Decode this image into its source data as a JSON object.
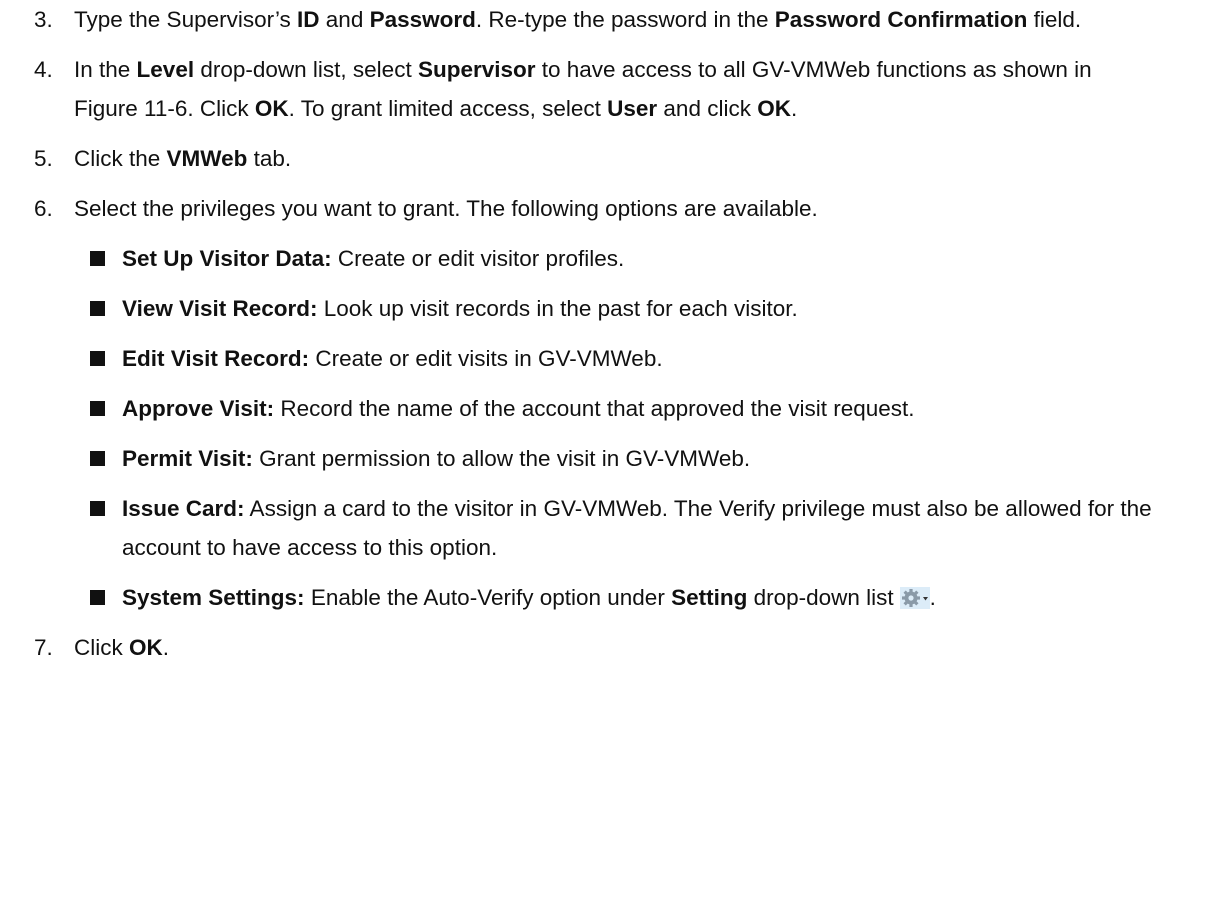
{
  "steps": [
    {
      "num": "3.",
      "parts": [
        {
          "t": "Type the Supervisor’s "
        },
        {
          "b": "ID"
        },
        {
          "t": " and "
        },
        {
          "b": "Password"
        },
        {
          "t": ". Re-type the password in the "
        },
        {
          "b": "Password Confirmation"
        },
        {
          "t": " field."
        }
      ]
    },
    {
      "num": "4.",
      "parts": [
        {
          "t": "In the "
        },
        {
          "b": "Level"
        },
        {
          "t": " drop-down list, select "
        },
        {
          "b": "Supervisor"
        },
        {
          "t": " to have access to all GV-VMWeb functions as shown in Figure 11-6. Click "
        },
        {
          "b": "OK"
        },
        {
          "t": ". To grant limited access, select "
        },
        {
          "b": "User"
        },
        {
          "t": " and click "
        },
        {
          "b": "OK"
        },
        {
          "t": "."
        }
      ]
    },
    {
      "num": "5.",
      "parts": [
        {
          "t": "Click the "
        },
        {
          "b": "VMWeb"
        },
        {
          "t": " tab."
        }
      ]
    },
    {
      "num": "6.",
      "parts": [
        {
          "t": "Select the privileges you want to grant. The following options are available."
        }
      ]
    }
  ],
  "privileges": [
    {
      "name": "Set Up Visitor Data:",
      "desc": " Create or edit visitor profiles."
    },
    {
      "name": "View Visit Record:",
      "desc": " Look up visit records in the past for each visitor."
    },
    {
      "name": "Edit Visit Record:",
      "desc": " Create or edit visits in GV-VMWeb."
    },
    {
      "name": "Approve Visit:",
      "desc": " Record the name of the account that approved the visit request."
    },
    {
      "name": "Permit Visit:",
      "desc": " Grant permission to allow the visit in GV-VMWeb."
    },
    {
      "name": "Issue Card:",
      "desc": " Assign a card to the visitor in GV-VMWeb. The Verify privilege must also be allowed for the account to have access to this option."
    }
  ],
  "system_settings": {
    "name": "System Settings:",
    "desc": " Enable the Auto-Verify option under ",
    "setting_label": "Setting",
    "desc_after": " drop-down list",
    "icon": "gear-dropdown-icon",
    "end": "."
  },
  "final_step": {
    "num": "7.",
    "text": "Click ",
    "bold": "OK",
    "end": "."
  }
}
